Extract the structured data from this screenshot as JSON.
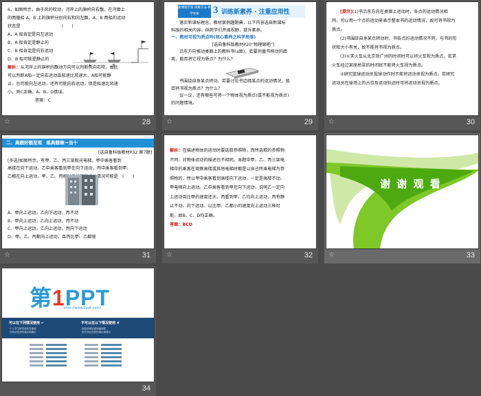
{
  "thumbnails": [
    {
      "num": "28",
      "lines": [
        "6．如图所示，由于风的吹动，河岸上的旗帜向右飘，在河面上",
        "的两艘船 A、B 上的旗帜分别向右和向左飘，A、B 两船的运动",
        "状态是",
        "A．A 船肯定是向左运动",
        "B．A 船肯定是静止的",
        "C．B 船肯定是向右运动",
        "D．B 船可能是静止的"
      ],
      "answer_label": "解析：",
      "answer_text": [
        "从河岸上的旗帜的飘动方向可以判断风向右吹，由此",
        "可以判断A船一定向右运动且船速比风速大，A船可能静",
        "止，也可能向左运动，还有可能向右运动，但是船速比风速",
        "小，则C正确，A、B、D错误。"
      ],
      "answer_tail": "答案：C",
      "paren": "(　　)"
    },
    {
      "num": "29",
      "tag": "新课程学案 统筹方法 教学生本",
      "n3": "3",
      "heading": "训练新素养 · 注重应用性",
      "lines": [
        "落实新课标理念，教材案例趣题典，以下内容选自新课标",
        "科版的相关内容，供同学们开阔视野，提升素养。"
      ],
      "sub": "一、教材可视为质点吗(核心素养之科学思维)",
      "ref": "[选自鲁科版教材P20“物理聊吧”]",
      "lines2": [
        "沿东方向推动桌面上的教科书(a图)，若要测量书移动的距",
        "离，能否将它视为质点？为什么？"
      ],
      "lines3": [
        "书围绕自身某点转动，若要讨论书边缘某点的运动情况，能",
        "否将书视为质点？为什么？"
      ],
      "lines4": [
        "议一议，还有哪些可将一个物体视为质点(或不能视为质点)",
        "的问题情境。"
      ]
    },
    {
      "num": "30",
      "hint": "[提示]",
      "lines": [
        "(1)书沿东方向在桌面上运动时，各点的运动情况相",
        "同，可以用一个点的运动来表示整本书的运动情况，故可将书视为",
        "质点。",
        "(2)书围绕自身某点转动时，书各点的运动情况不同，与书的形",
        "状和大小有关，故不能将书视为质点。",
        "(3)①求火车从北京到广州的时间时可以将火车视为质点，若求",
        "火车经过某座桥梁的时间就不能将火车视为质点。",
        "②研究篮球运动员投球动作时不能将运动员视为质点，若研究",
        "运动员在球场上的占位及运动轨迹时可将运动员视为质点。"
      ]
    },
    {
      "num": "31",
      "bar": "二、典题好题发现　练典题做一当十",
      "ref": "[选自鲁科版教材P32 第7题]",
      "lines": [
        "[多选]如图所示，有甲、乙、丙三架观光电梯，甲中乘客看到",
        "高楼在向下运动，乙中乘客看到甲在向下运动，丙中乘客看到甲、",
        "乙都在向上运动，甲、乙、丙相对于地面的运动情况可能是　(　　)"
      ],
      "options": [
        "A．甲向上运动，乙向下运动，丙不动",
        "B．甲向上运动，乙向上运动，丙不动",
        "C．甲向上运动，乙向上运动，丙向下运动",
        "D．甲、乙、丙都向上运动，且丙比甲、乙都慢"
      ]
    },
    {
      "num": "32",
      "label": "解析：",
      "lines": [
        "在描述物体的运动时要选取参照物，而所选取的参照物",
        "不同，对物体运动的描述也不相同。本题中甲、乙、丙三架电",
        "梯中的乘客在观察高楼或其他电梯时都是以自己所乘电梯为参",
        "照物的，所以甲中乘客看到高楼向下运动，一定是高楼不动、",
        "甲电梯向上运动。乙中乘客看到甲在向下运动，说明乙一定向",
        "上运动且比甲的速度还大。丙看到甲、乙均向上运动，丙有静",
        "止不动、向下运动、以比甲、乙都小的速度向上运动三种可",
        "能，故B、C、D均正确。"
      ],
      "answer": "答案：BCD"
    },
    {
      "num": "33",
      "title": "谢 谢 观 看"
    },
    {
      "num": "34",
      "logo_a": "第",
      "logo_b": "1",
      "logo_c": "PPT",
      "url": "http://www.1ppt.com/",
      "left_title": "可以在下列情况使用 ✔",
      "right_title": "不可以在以下情况使用 ✘",
      "left_sub": [
        "·个人学习研究或欣赏使用",
        "·非商业性质的演示和展示"
      ],
      "right_sub": [
        "·复制到网站或网盘销售",
        "·用于商业性质的演示和展示"
      ]
    }
  ]
}
